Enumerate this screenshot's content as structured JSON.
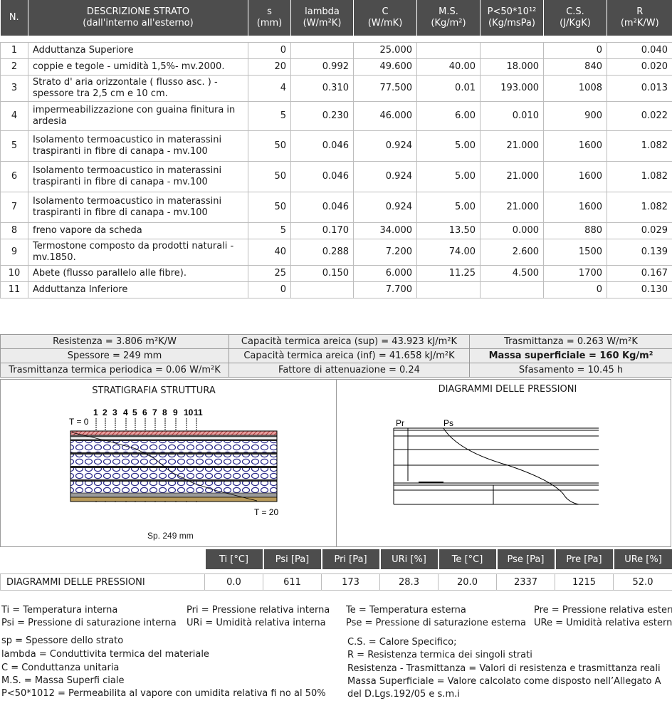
{
  "headers": [
    {
      "main": "N.",
      "unit": ""
    },
    {
      "main": "DESCRIZIONE STRATO",
      "unit": "(dall'interno all'esterno)"
    },
    {
      "main": "s",
      "unit": "(mm)"
    },
    {
      "main": "lambda",
      "unit": "(W/m²K)"
    },
    {
      "main": "C",
      "unit": "(W/mK)"
    },
    {
      "main": "M.S.",
      "unit": "(Kg/m²)"
    },
    {
      "main": "P<50*10¹²",
      "unit": "(Kg/msPa)"
    },
    {
      "main": "C.S.",
      "unit": "(J/KgK)"
    },
    {
      "main": "R",
      "unit": "(m²K/W)"
    }
  ],
  "rows": [
    {
      "n": "1",
      "desc": "Adduttanza Superiore",
      "s": "0",
      "lambda": "",
      "c": "25.000",
      "ms": "",
      "p": "",
      "cs": "0",
      "r": "0.040"
    },
    {
      "n": "2",
      "desc": "coppie e tegole - umidità 1,5%- mv.2000.",
      "s": "20",
      "lambda": "0.992",
      "c": "49.600",
      "ms": "40.00",
      "p": "18.000",
      "cs": "840",
      "r": "0.020"
    },
    {
      "n": "3",
      "desc": "Strato d' aria orizzontale ( flusso asc. ) - spessore tra 2,5 cm e 10 cm.",
      "s": "4",
      "lambda": "0.310",
      "c": "77.500",
      "ms": "0.01",
      "p": "193.000",
      "cs": "1008",
      "r": "0.013"
    },
    {
      "n": "4",
      "desc": "impermeabilizzazione con guaina finitura in ardesia",
      "s": "5",
      "lambda": "0.230",
      "c": "46.000",
      "ms": "6.00",
      "p": "0.010",
      "cs": "900",
      "r": "0.022"
    },
    {
      "n": "5",
      "desc": "Isolamento termoacustico in materassini traspiranti in fibre di canapa - mv.100",
      "s": "50",
      "lambda": "0.046",
      "c": "0.924",
      "ms": "5.00",
      "p": "21.000",
      "cs": "1600",
      "r": "1.082"
    },
    {
      "n": "6",
      "desc": "Isolamento termoacustico in materassini traspiranti in fibre di canapa - mv.100",
      "s": "50",
      "lambda": "0.046",
      "c": "0.924",
      "ms": "5.00",
      "p": "21.000",
      "cs": "1600",
      "r": "1.082"
    },
    {
      "n": "7",
      "desc": "Isolamento termoacustico in materassini traspiranti in fibre di canapa - mv.100",
      "s": "50",
      "lambda": "0.046",
      "c": "0.924",
      "ms": "5.00",
      "p": "21.000",
      "cs": "1600",
      "r": "1.082"
    },
    {
      "n": "8",
      "desc": "freno vapore da scheda",
      "s": "5",
      "lambda": "0.170",
      "c": "34.000",
      "ms": "13.50",
      "p": "0.000",
      "cs": "880",
      "r": "0.029"
    },
    {
      "n": "9",
      "desc": "Termostone composto da prodotti naturali  - mv.1850.",
      "s": "40",
      "lambda": "0.288",
      "c": "7.200",
      "ms": "74.00",
      "p": "2.600",
      "cs": "1500",
      "r": "0.139"
    },
    {
      "n": "10",
      "desc": "Abete (flusso parallelo alle fibre).",
      "s": "25",
      "lambda": "0.150",
      "c": "6.000",
      "ms": "11.25",
      "p": "4.500",
      "cs": "1700",
      "r": "0.167"
    },
    {
      "n": "11",
      "desc": "Adduttanza Inferiore",
      "s": "0",
      "lambda": "",
      "c": "7.700",
      "ms": "",
      "p": "",
      "cs": "0",
      "r": "0.130"
    }
  ],
  "summary": {
    "resistenza": "Resistenza = 3.806 m²K/W",
    "cap_sup": "Capacità termica areica (sup) = 43.923 kJ/m²K",
    "trasmittanza": "Trasmittanza = 0.263 W/m²K",
    "spessore": "Spessore = 249 mm",
    "cap_inf": "Capacità termica areica (inf) = 41.658 kJ/m²K",
    "massa": "Massa superficiale = 160 Kg/m²",
    "trasm_periodica": "Trasmittanza termica periodica = 0.06 W/m²K",
    "attenuazione": "Fattore di attenuazione = 0.24",
    "sfasamento": "Sfasamento = 10.45 h"
  },
  "stratigrafia": {
    "title": "STRATIGRAFIA STRUTTURA",
    "layer_numbers": [
      "1",
      "2",
      "3",
      "4",
      "5",
      "6",
      "7",
      "8",
      "9",
      "10",
      "11"
    ],
    "t_in": "T = 0",
    "t_out": "T = 20",
    "thickness": "Sp. 249 mm"
  },
  "pressioni": {
    "title": "DIAGRAMMI DELLE PRESSIONI",
    "pr_label": "Pr",
    "ps_label": "Ps"
  },
  "press_table": {
    "headers": [
      "Ti [°C]",
      "Psi [Pa]",
      "Pri [Pa]",
      "URi [%]",
      "Te [°C]",
      "Pse [Pa]",
      "Pre [Pa]",
      "URe [%]"
    ],
    "label": "DIAGRAMMI DELLE PRESSIONI",
    "values": [
      "0.0",
      "611",
      "173",
      "28.3",
      "20.0",
      "2337",
      "1215",
      "52.0"
    ]
  },
  "legend": {
    "ti": "Ti = Temperatura interna",
    "psi": "Psi = Pressione di saturazione interna",
    "pri": "Pri = Pressione relativa interna",
    "uri": "URi = Umidità relativa interna",
    "te": "Te = Temperatura esterna",
    "pse": "Pse = Pressione di saturazione esterna",
    "pre": "Pre = Pressione relativa esterna",
    "ure": "URe = Umidità relativa esterna",
    "sp": "sp = Spessore dello strato",
    "lambda": "lambda = Conduttivita termica del materiale",
    "c": "C = Conduttanza unitaria",
    "ms": "M.S. = Massa Superfi ciale",
    "p": "P<50*1012 = Permeabilita al vapore con umidita relativa fi no al 50%",
    "cs": "C.S. = Calore Specifico;",
    "r": "R = Resistenza termica dei singoli strati",
    "res_tra": "Resistenza - Trasmittanza = Valori di resistenza e trasmittanza reali",
    "massa1": "Massa Superficiale = Valore calcolato come disposto nell’Allegato A",
    "massa2": "del D.Lgs.192/05 e s.m.i"
  }
}
